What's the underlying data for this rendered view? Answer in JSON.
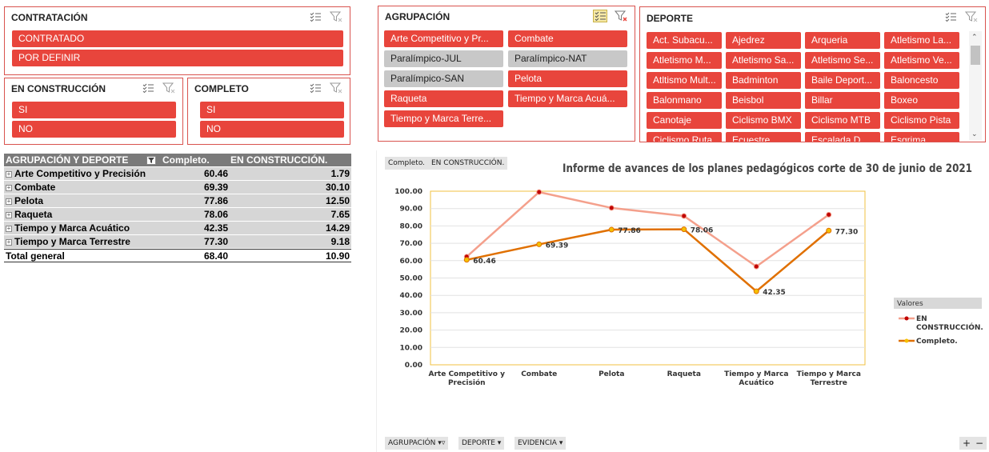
{
  "slicers": {
    "contratacion": {
      "title": "CONTRATACIÓN",
      "items": [
        "CONTRATADO",
        "POR DEFINIR"
      ]
    },
    "en_construccion": {
      "title": "EN CONSTRUCCIÓN",
      "items": [
        "SI",
        "NO"
      ]
    },
    "completo": {
      "title": "COMPLETO",
      "items": [
        "SI",
        "NO"
      ]
    },
    "agrupacion": {
      "title": "AGRUPACIÓN",
      "items": [
        {
          "label": "Arte Competitivo y Pr...",
          "state": "selected"
        },
        {
          "label": "Combate",
          "state": "selected"
        },
        {
          "label": "Paralímpico-JUL",
          "state": "unselected"
        },
        {
          "label": "Paralímpico-NAT",
          "state": "unselected"
        },
        {
          "label": "Paralímpico-SAN",
          "state": "unselected"
        },
        {
          "label": "Pelota",
          "state": "selected"
        },
        {
          "label": "Raqueta",
          "state": "selected"
        },
        {
          "label": "Tiempo y Marca Acuá...",
          "state": "selected"
        },
        {
          "label": "Tiempo y Marca Terre...",
          "state": "selected"
        }
      ]
    },
    "deporte": {
      "title": "DEPORTE",
      "items": [
        "Act. Subacu...",
        "Ajedrez",
        "Arqueria",
        "Atletismo La...",
        "Atletismo M...",
        "Atletismo Sa...",
        "Atletismo Se...",
        "Atletismo Ve...",
        "Atltismo Mult...",
        "Badminton",
        "Baile Deport...",
        "Baloncesto",
        "Balonmano",
        "Beisbol",
        "Billar",
        "Boxeo",
        "Canotaje",
        "Ciclismo BMX",
        "Ciclismo MTB",
        "Ciclismo Pista",
        "Ciclismo Ruta",
        "Ecuestre",
        "Escalada D...",
        "Esgrima"
      ]
    }
  },
  "pivot": {
    "headers": [
      "AGRUPACIÓN Y DEPORTE",
      "Completo.",
      "EN CONSTRUCCIÓN."
    ],
    "rows": [
      {
        "name": "Arte Competitivo y Precisión",
        "completo": "60.46",
        "construccion": "1.79"
      },
      {
        "name": "Combate",
        "completo": "69.39",
        "construccion": "30.10"
      },
      {
        "name": "Pelota",
        "completo": "77.86",
        "construccion": "12.50"
      },
      {
        "name": "Raqueta",
        "completo": "78.06",
        "construccion": "7.65"
      },
      {
        "name": "Tiempo y Marca Acuático",
        "completo": "42.35",
        "construccion": "14.29"
      },
      {
        "name": "Tiempo y Marca Terrestre",
        "completo": "77.30",
        "construccion": "9.18"
      }
    ],
    "total": {
      "name": "Total general",
      "completo": "68.40",
      "construccion": "10.90"
    }
  },
  "chart_tags": [
    "Completo.",
    "EN CONSTRUCCIÓN."
  ],
  "bottom_fields": [
    "AGRUPACIÓN",
    "DEPORTE",
    "EVIDENCIA"
  ],
  "zoom_buttons": [
    "+",
    "−"
  ],
  "colors": {
    "red": "#e8453c",
    "gray": "#c8c8c8",
    "line_light": "#f4a08c",
    "line_dark": "#e07000"
  },
  "chart_data": {
    "type": "line",
    "title": "Informe de avances de los planes pedagógicos corte de 30 de junio de 2021",
    "categories": [
      "Arte Competitivo y Precisión",
      "Combate",
      "Pelota",
      "Raqueta",
      "Tiempo y Marca Acuático",
      "Tiempo y Marca Terrestre"
    ],
    "category_lines": [
      [
        "Arte Competitivo y",
        "Precisión"
      ],
      [
        "Combate"
      ],
      [
        "Pelota"
      ],
      [
        "Raqueta"
      ],
      [
        "Tiempo y Marca",
        "Acuático"
      ],
      [
        "Tiempo y Marca",
        "Terrestre"
      ]
    ],
    "series": [
      {
        "name": "EN CONSTRUCCIÓN.",
        "values": [
          62.25,
          99.49,
          90.36,
          85.71,
          56.64,
          86.48
        ],
        "color": "#f4a08c",
        "marker": "#c00000",
        "show_labels": false
      },
      {
        "name": "Completo.",
        "values": [
          60.46,
          69.39,
          77.86,
          78.06,
          42.35,
          77.3
        ],
        "color": "#e07000",
        "marker": "#f5c000",
        "show_labels": true
      }
    ],
    "legend_title": "Valores",
    "legend_labels": [
      [
        "EN",
        "CONSTRUCCIÓN."
      ],
      [
        "Completo."
      ]
    ],
    "ylim": [
      0,
      100
    ],
    "yticks": [
      "0.00",
      "10.00",
      "20.00",
      "30.00",
      "40.00",
      "50.00",
      "60.00",
      "70.00",
      "80.00",
      "90.00",
      "100.00"
    ],
    "grid": true,
    "legend": "right"
  }
}
